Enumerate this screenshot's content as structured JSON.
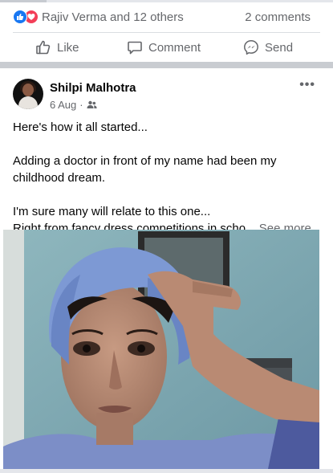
{
  "reactions": {
    "summary": "Rajiv Verma and 12 others",
    "comments_count": "2 comments"
  },
  "actions": {
    "like_label": "Like",
    "comment_label": "Comment",
    "send_label": "Send"
  },
  "post": {
    "author": "Shilpi Malhotra",
    "date": "6 Aug",
    "audience_icon": "friends-icon",
    "more_icon": "more-options-icon",
    "more_glyph": "•••",
    "lines": [
      "Here's how it all started...",
      "Adding a doctor in front of my name had been my childhood dream.",
      "I'm sure many will relate to this one...",
      "Right from fancy dress competitions in scho..."
    ],
    "see_more": "See more"
  },
  "colors": {
    "like_blue": "#1877f2",
    "love_red": "#f33e58",
    "secondary_text": "#65676b",
    "primary_text": "#050505"
  }
}
